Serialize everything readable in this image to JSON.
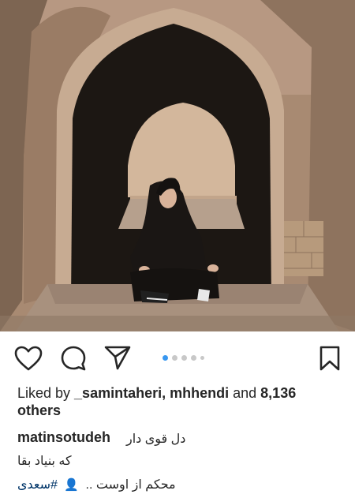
{
  "post": {
    "photo_alt": "",
    "carousel": {
      "count": 5,
      "active_index": 0
    },
    "likes": {
      "prefix": "Liked by ",
      "user1": "_samintaheri",
      "separator": ", ",
      "user2": "mhhendi",
      "middle": " and ",
      "count": "8,136",
      "suffix": " others"
    },
    "caption": {
      "username": "matinsotudeh",
      "line1": "دل قوی دار",
      "line2": "که بنیاد بقا",
      "line3_text": "محکم از اوست ..",
      "line3_hashtag": "#سعدی"
    }
  },
  "icons": {
    "like": "heart-icon",
    "comment": "comment-icon",
    "share": "send-icon",
    "save": "bookmark-icon",
    "user": "person-icon"
  },
  "colors": {
    "carousel_active": "#3897f0",
    "carousel_inactive": "#c8c8c8",
    "hashtag": "#003569",
    "text": "#262626"
  }
}
